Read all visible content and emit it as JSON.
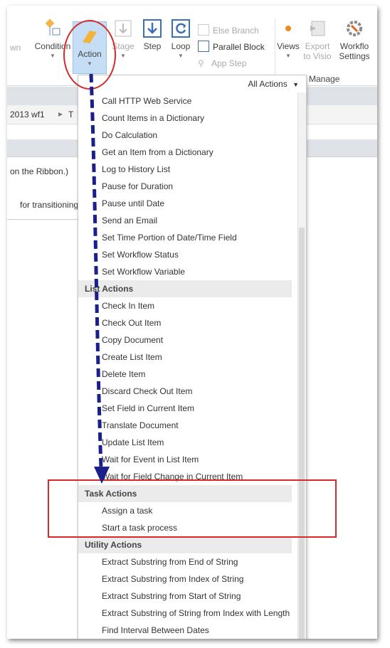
{
  "ribbon": {
    "partial_left_label": "wn",
    "condition_label": "Condition",
    "action_label": "Action",
    "stage_label": "Stage",
    "step_label": "Step",
    "loop_label": "Loop",
    "else_branch_label": "Else Branch",
    "parallel_block_label": "Parallel Block",
    "app_step_label": "App Step",
    "views_label": "Views",
    "export_label_1": "Export",
    "export_label_2": "to Visio",
    "workflow_label_1": "Workflo",
    "workflow_label_2": "Settings",
    "manage_group_label": "Manage"
  },
  "breadcrumb": {
    "item": "2013 wf1",
    "next": "T"
  },
  "designer": {
    "hint_text": "on the Ribbon.)",
    "transition_text": "for transitioning"
  },
  "dropdown": {
    "header_label": "All Actions",
    "core_items": [
      "Call HTTP Web Service",
      "Count Items in a Dictionary",
      "Do Calculation",
      "Get an Item from a Dictionary",
      "Log to History List",
      "Pause for Duration",
      "Pause until Date",
      "Send an Email",
      "Set Time Portion of Date/Time Field",
      "Set Workflow Status",
      "Set Workflow Variable"
    ],
    "list_category": "List Actions",
    "list_items": [
      "Check In Item",
      "Check Out Item",
      "Copy Document",
      "Create List Item",
      "Delete Item",
      "Discard Check Out Item",
      "Set Field in Current Item",
      "Translate Document",
      "Update List Item",
      "Wait for Event in List Item",
      "Wait for Field Change in Current Item"
    ],
    "task_category": "Task Actions",
    "task_items": [
      "Assign a task",
      "Start a task process"
    ],
    "utility_category": "Utility Actions",
    "utility_items": [
      "Extract Substring from End of String",
      "Extract Substring from Index of String",
      "Extract Substring from Start of String",
      "Extract Substring of String from Index with Length",
      "Find Interval Between Dates"
    ]
  },
  "colors": {
    "annotation_red": "#d62a2a",
    "arrow_navy": "#1a1f8a",
    "selected_blue": "#c5def5"
  }
}
